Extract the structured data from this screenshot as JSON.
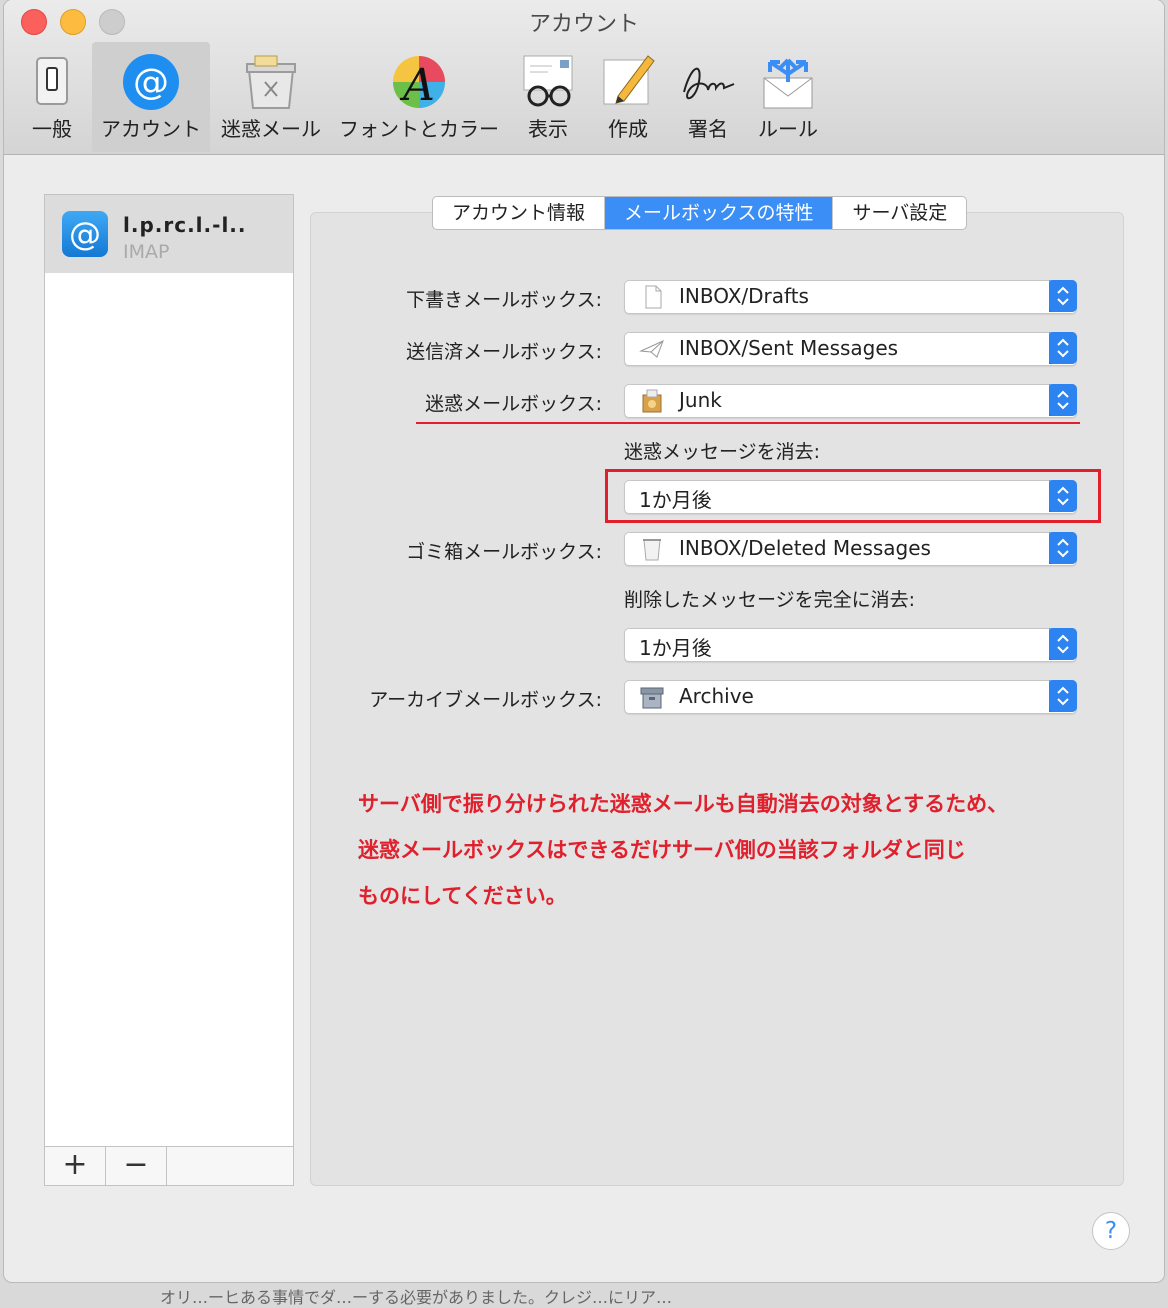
{
  "window": {
    "title": "アカウント"
  },
  "toolbar": {
    "items": [
      {
        "label": "一般",
        "icon": "switch-icon"
      },
      {
        "label": "アカウント",
        "icon": "at-sign-icon"
      },
      {
        "label": "迷惑メール",
        "icon": "junk-trash-icon"
      },
      {
        "label": "フォントとカラー",
        "icon": "font-color-icon"
      },
      {
        "label": "表示",
        "icon": "glasses-icon"
      },
      {
        "label": "作成",
        "icon": "pencil-icon"
      },
      {
        "label": "署名",
        "icon": "signature-icon"
      },
      {
        "label": "ルール",
        "icon": "rules-envelope-icon"
      }
    ]
  },
  "sidebar": {
    "account": {
      "name": "l.p.rc.l.-l..",
      "type": "IMAP"
    },
    "add_label": "+",
    "remove_label": "−"
  },
  "tabs": [
    {
      "label": "アカウント情報",
      "active": false
    },
    {
      "label": "メールボックスの特性",
      "active": true
    },
    {
      "label": "サーバ設定",
      "active": false
    }
  ],
  "form": {
    "drafts": {
      "label": "下書きメールボックス:",
      "value": "INBOX/Drafts",
      "icon": "document-icon"
    },
    "sent": {
      "label": "送信済メールボックス:",
      "value": "INBOX/Sent Messages",
      "icon": "paper-plane-icon"
    },
    "junk": {
      "label": "迷惑メールボックス:",
      "value": "Junk",
      "icon": "junk-box-icon"
    },
    "junk_erase": {
      "label": "迷惑メッセージを消去:",
      "value": "1か月後"
    },
    "trash": {
      "label": "ゴミ箱メールボックス:",
      "value": "INBOX/Deleted Messages",
      "icon": "trash-icon"
    },
    "trash_erase": {
      "label": "削除したメッセージを完全に消去:",
      "value": "1か月後"
    },
    "archive": {
      "label": "アーカイブメールボックス:",
      "value": "Archive",
      "icon": "archive-box-icon"
    }
  },
  "annotation": {
    "lines": [
      "サーバ側で振り分けられた迷惑メールも自動消去の対象とするため、",
      "迷惑メールボックスはできるだけサーバ側の当該フォルダと同じ",
      "ものにしてください。"
    ],
    "color": "#e0202c"
  },
  "help": {
    "label": "?"
  },
  "background_text": "オリ…ーヒある事情でダ…ーする必要がありました。クレジ…にリア…",
  "colors": {
    "accent": "#3a8ef5",
    "annotation_red": "#e0202c"
  }
}
